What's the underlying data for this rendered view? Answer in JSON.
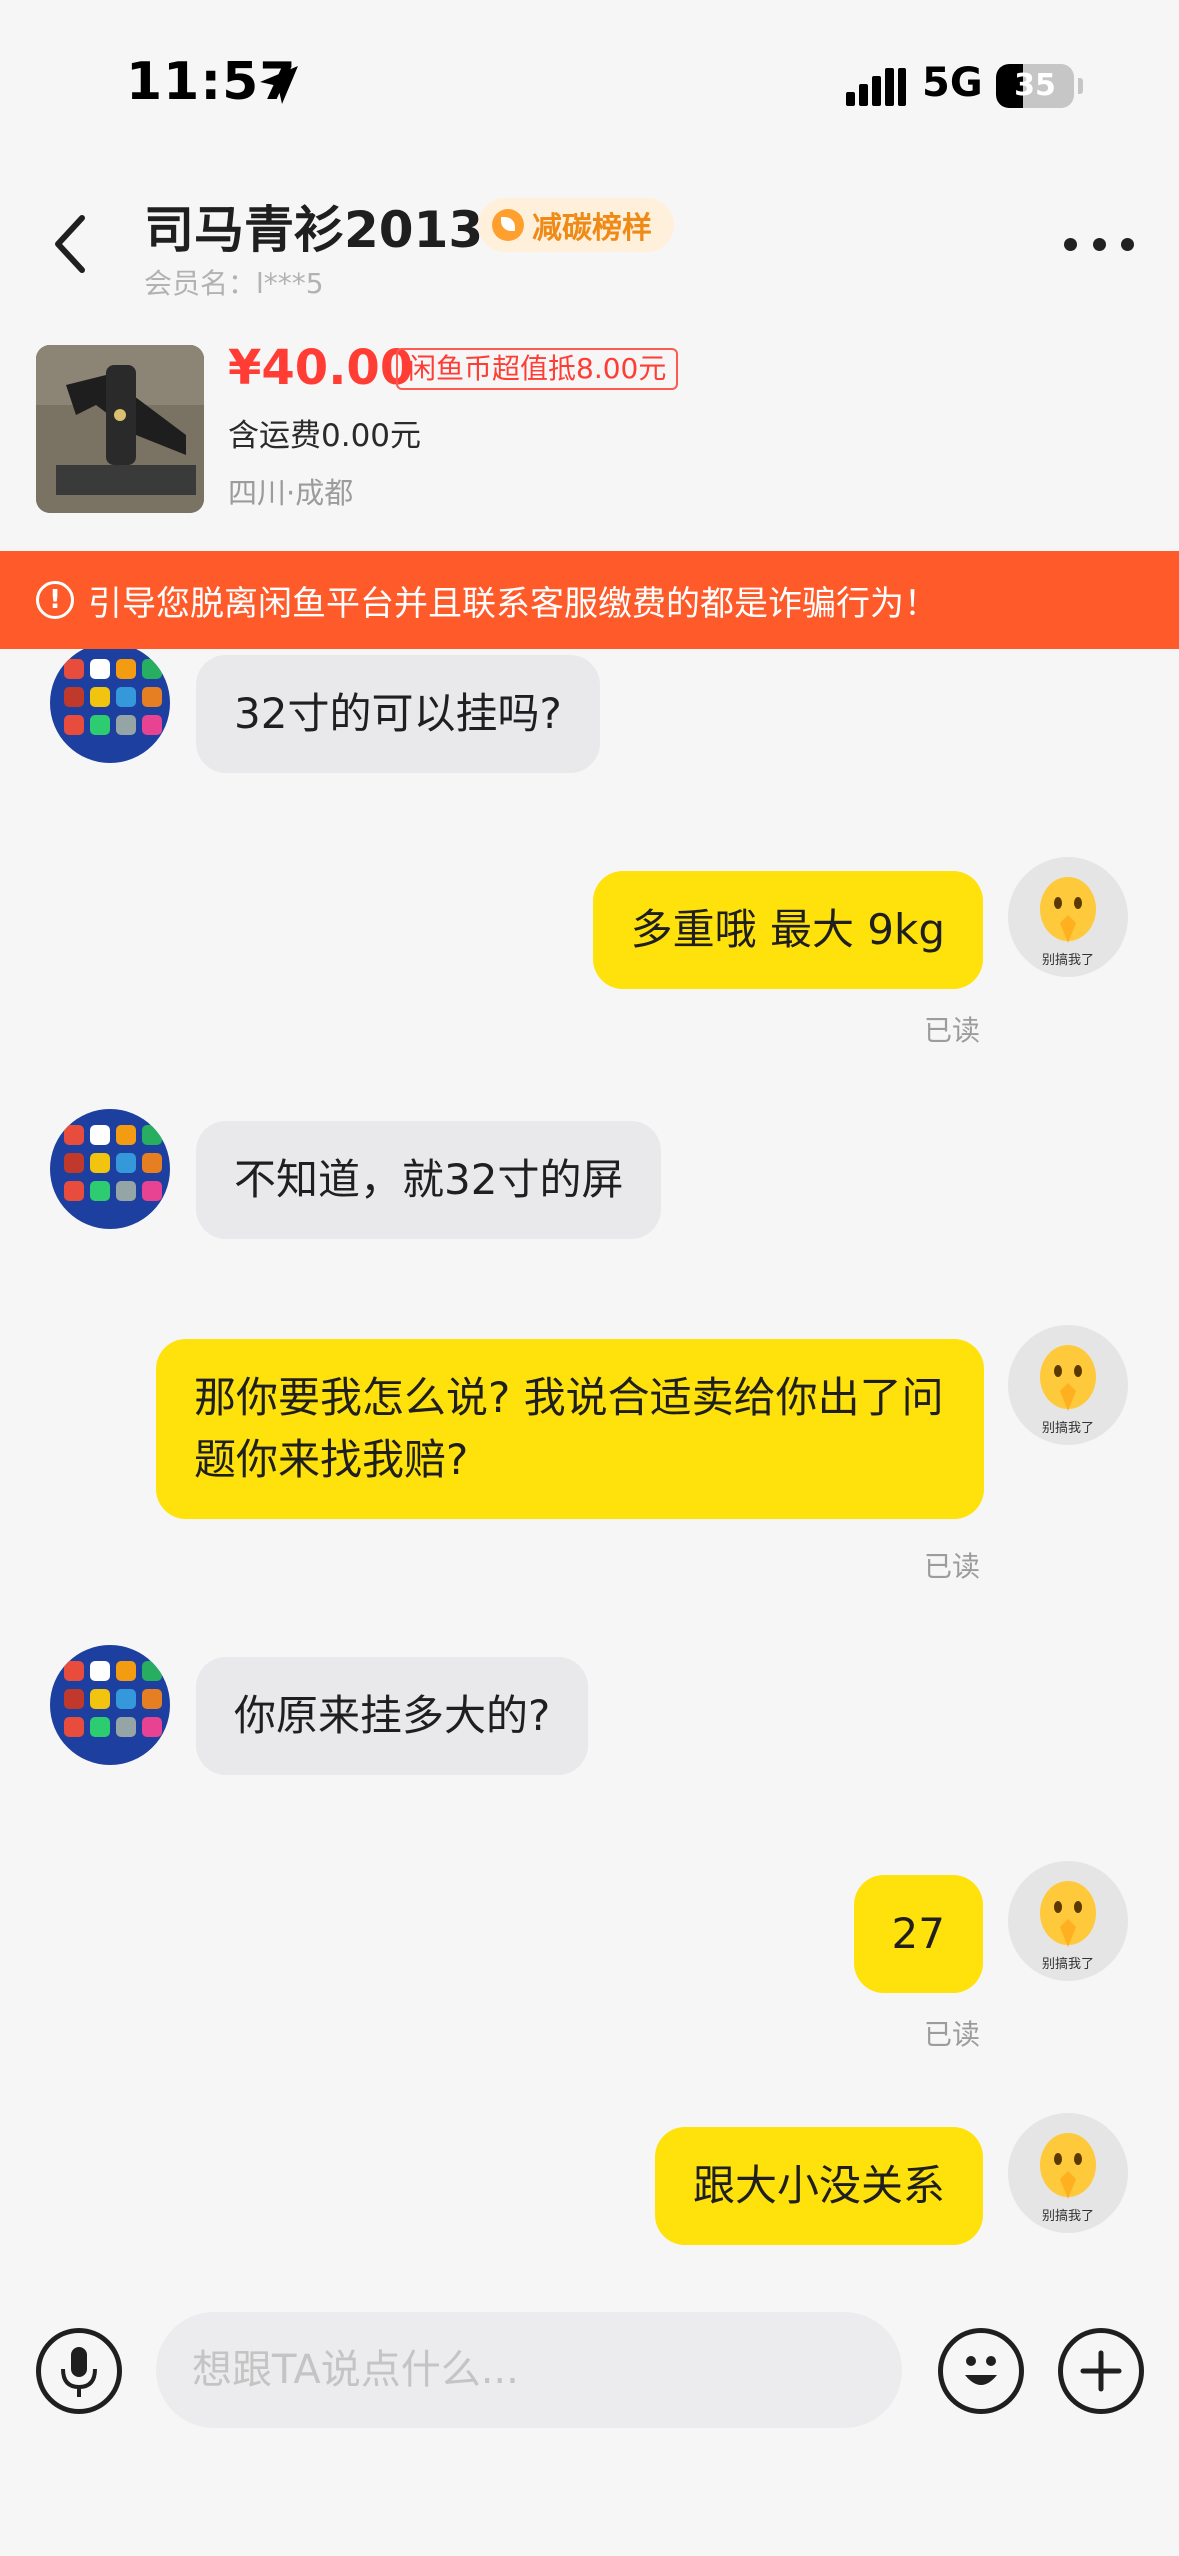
{
  "status_bar": {
    "time": "11:57",
    "network": "5G",
    "battery": "35",
    "battery_level": 0.35,
    "location_icon": "location-arrow-icon",
    "signal_icon": "signal-bars-icon"
  },
  "header": {
    "name": "司马青衫2013",
    "badge": "减碳榜样",
    "member": "会员名：l***5",
    "back_icon": "chevron-left-icon",
    "more_icon": "more-dots-icon"
  },
  "product": {
    "price": "¥40.00",
    "coin_offer": "闲鱼币超值抵8.00元",
    "shipping": "含运费0.00元",
    "location": "四川·成都"
  },
  "warning": {
    "icon_glyph": "!",
    "text": "引导您脱离闲鱼平台并且联系客服缴费的都是诈骗行为！"
  },
  "avatar_caption": "别搞我了",
  "messages": [
    {
      "side": "in",
      "text": "32寸的可以挂吗?"
    },
    {
      "side": "out",
      "text": "多重哦  最大 9kg",
      "status": "已读"
    },
    {
      "side": "in",
      "text": "不知道，就32寸的屏"
    },
    {
      "side": "out",
      "text": "那你要我怎么说?   我说合适卖给你出了问题你来找我赔?",
      "status": "已读"
    },
    {
      "side": "in",
      "text": "你原来挂多大的?"
    },
    {
      "side": "out",
      "text": "27",
      "status": "已读"
    },
    {
      "side": "out",
      "text": "跟大小没关系"
    }
  ],
  "input": {
    "placeholder": "想跟TA说点什么...",
    "mic_icon": "microphone-icon",
    "emoji_icon": "smiley-face-icon",
    "plus_icon": "plus-icon"
  },
  "colors": {
    "accent_yellow": "#ffe10c",
    "price_red": "#ff3d35",
    "warning_orange": "#ff5a2a",
    "incoming_bubble": "#e9e9ec"
  }
}
